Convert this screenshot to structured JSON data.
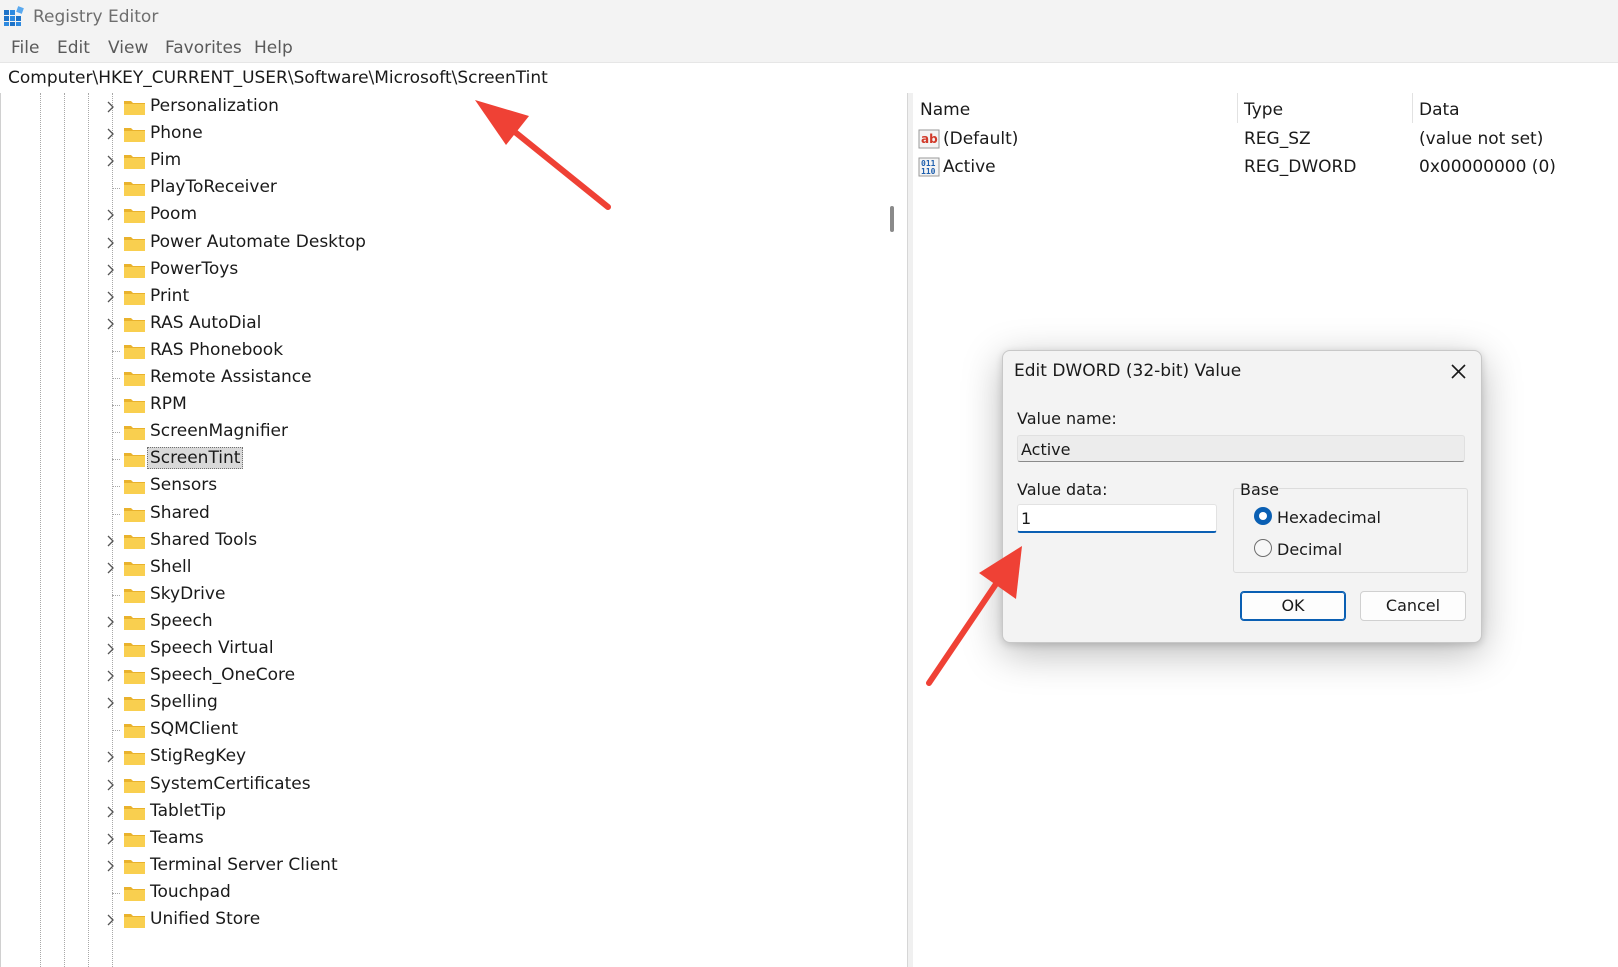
{
  "window": {
    "title": "Registry Editor"
  },
  "menu": [
    "File",
    "Edit",
    "View",
    "Favorites",
    "Help"
  ],
  "address": "Computer\\HKEY_CURRENT_USER\\Software\\Microsoft\\ScreenTint",
  "tree": {
    "selected": "ScreenTint",
    "items": [
      {
        "label": "Personalization",
        "expandable": true
      },
      {
        "label": "Phone",
        "expandable": true
      },
      {
        "label": "Pim",
        "expandable": true
      },
      {
        "label": "PlayToReceiver",
        "expandable": false
      },
      {
        "label": "Poom",
        "expandable": true
      },
      {
        "label": "Power Automate Desktop",
        "expandable": true
      },
      {
        "label": "PowerToys",
        "expandable": true
      },
      {
        "label": "Print",
        "expandable": true
      },
      {
        "label": "RAS AutoDial",
        "expandable": true
      },
      {
        "label": "RAS Phonebook",
        "expandable": false
      },
      {
        "label": "Remote Assistance",
        "expandable": false
      },
      {
        "label": "RPM",
        "expandable": false
      },
      {
        "label": "ScreenMagnifier",
        "expandable": false
      },
      {
        "label": "ScreenTint",
        "expandable": false
      },
      {
        "label": "Sensors",
        "expandable": false
      },
      {
        "label": "Shared",
        "expandable": false
      },
      {
        "label": "Shared Tools",
        "expandable": true
      },
      {
        "label": "Shell",
        "expandable": true
      },
      {
        "label": "SkyDrive",
        "expandable": false
      },
      {
        "label": "Speech",
        "expandable": true
      },
      {
        "label": "Speech Virtual",
        "expandable": true
      },
      {
        "label": "Speech_OneCore",
        "expandable": true
      },
      {
        "label": "Spelling",
        "expandable": true
      },
      {
        "label": "SQMClient",
        "expandable": false
      },
      {
        "label": "StigRegKey",
        "expandable": true
      },
      {
        "label": "SystemCertificates",
        "expandable": true
      },
      {
        "label": "TabletTip",
        "expandable": true
      },
      {
        "label": "Teams",
        "expandable": true
      },
      {
        "label": "Terminal Server Client",
        "expandable": true
      },
      {
        "label": "Touchpad",
        "expandable": false
      },
      {
        "label": "Unified Store",
        "expandable": true
      }
    ]
  },
  "values": {
    "columns": {
      "name": "Name",
      "type": "Type",
      "data": "Data"
    },
    "rows": [
      {
        "name": "(Default)",
        "type": "REG_SZ",
        "data": "(value not set)",
        "icon": "string-value-icon"
      },
      {
        "name": "Active",
        "type": "REG_DWORD",
        "data": "0x00000000 (0)",
        "icon": "binary-value-icon"
      }
    ]
  },
  "dialog": {
    "title": "Edit DWORD (32-bit) Value",
    "value_name_label": "Value name:",
    "value_name": "Active",
    "value_data_label": "Value data:",
    "value_data": "1",
    "base_label": "Base",
    "base_options": [
      "Hexadecimal",
      "Decimal"
    ],
    "base_selected": "Hexadecimal",
    "ok_label": "OK",
    "cancel_label": "Cancel"
  },
  "colors": {
    "accent": "#0a5fb3",
    "annotation_arrow": "#ef4135",
    "folder": "#f5c542"
  }
}
